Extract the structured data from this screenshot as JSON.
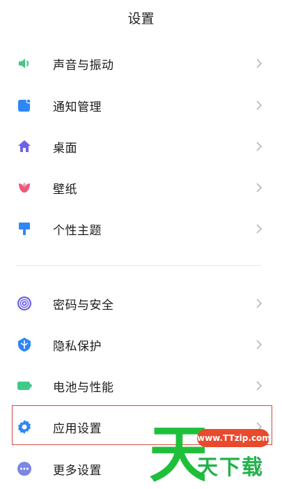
{
  "header": {
    "title": "设置"
  },
  "rows": [
    {
      "label": "声音与振动",
      "icon": "speaker-icon",
      "color": "#3fca87"
    },
    {
      "label": "通知管理",
      "icon": "notification-icon",
      "color": "#2f86f6"
    },
    {
      "label": "桌面",
      "icon": "home-icon",
      "color": "#6e62e8"
    },
    {
      "label": "壁纸",
      "icon": "tulip-icon",
      "color": "#f0587a"
    },
    {
      "label": "个性主题",
      "icon": "brush-icon",
      "color": "#2f86f6"
    },
    {
      "label": "密码与安全",
      "icon": "fingerprint-icon",
      "color": "#6e62e8"
    },
    {
      "label": "隐私保护",
      "icon": "shield-icon",
      "color": "#2f86f6"
    },
    {
      "label": "电池与性能",
      "icon": "battery-icon",
      "color": "#3fca87"
    },
    {
      "label": "应用设置",
      "icon": "gear-icon",
      "color": "#2f86f6"
    },
    {
      "label": "更多设置",
      "icon": "more-dots-icon",
      "color": "#7b86e8"
    }
  ],
  "watermark": {
    "url": "www.TTzip.com",
    "text": "天下载",
    "big_char": "天"
  }
}
